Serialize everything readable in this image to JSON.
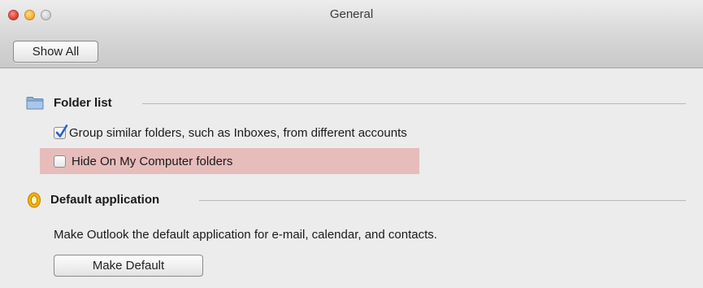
{
  "window": {
    "title": "General"
  },
  "toolbar": {
    "show_all_label": "Show All"
  },
  "folder_list": {
    "title": "Folder list",
    "icon": "folder-icon",
    "options": [
      {
        "label": "Group similar folders, such as Inboxes, from different accounts",
        "checked": true
      },
      {
        "label": "Hide On My Computer folders",
        "checked": false,
        "highlighted": true
      }
    ]
  },
  "default_application": {
    "title": "Default application",
    "icon": "outlook-icon",
    "description": "Make Outlook the default application for e-mail, calendar, and contacts.",
    "button_label": "Make Default"
  },
  "colors": {
    "highlight": "#e6bdbb",
    "checkmark": "#2a63c7",
    "outlook_accent": "#f0a800"
  }
}
